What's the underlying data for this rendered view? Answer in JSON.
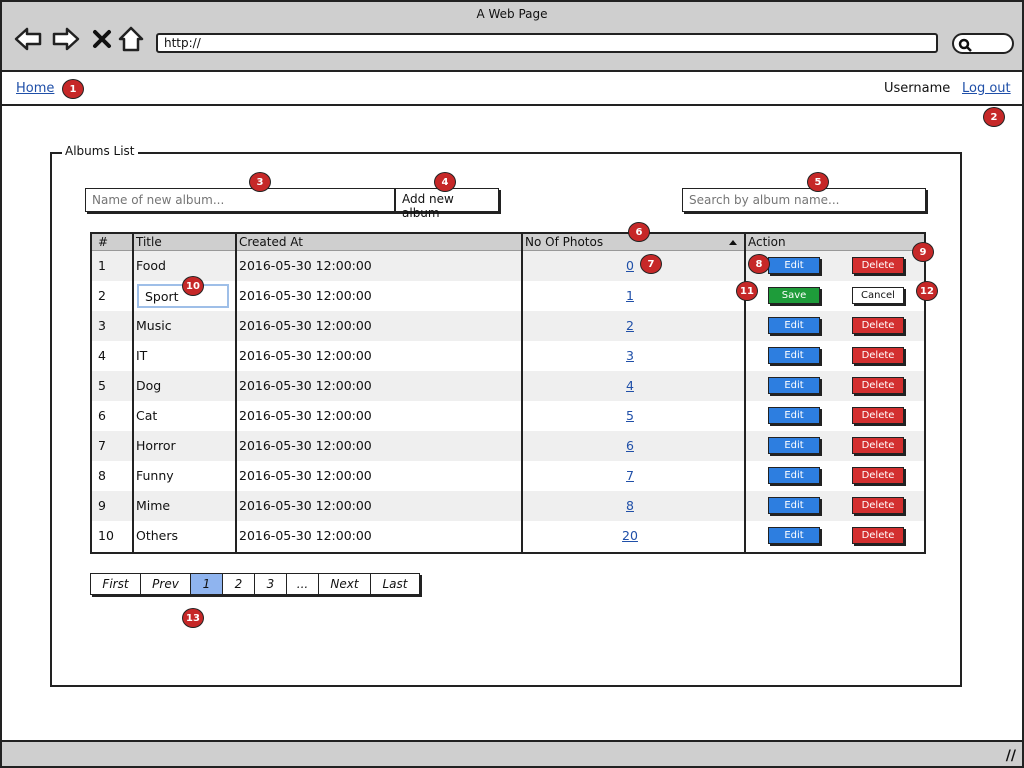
{
  "window": {
    "title": "A Web Page",
    "url": "http://"
  },
  "topnav": {
    "home": "Home",
    "username": "Username",
    "logout": "Log out"
  },
  "panel": {
    "legend": "Albums List"
  },
  "form": {
    "new_album_placeholder": "Name of new album...",
    "add_button": "Add new album",
    "search_placeholder": "Search by album name..."
  },
  "table": {
    "headers": [
      "#",
      "Title",
      "Created At",
      "No Of Photos",
      "Action"
    ],
    "rows": [
      {
        "num": "1",
        "title": "Food",
        "created": "2016-05-30 12:00:00",
        "photos": "0"
      },
      {
        "num": "2",
        "title": "Sport",
        "created": "2016-05-30 12:00:00",
        "photos": "1"
      },
      {
        "num": "3",
        "title": "Music",
        "created": "2016-05-30 12:00:00",
        "photos": "2"
      },
      {
        "num": "4",
        "title": "IT",
        "created": "2016-05-30 12:00:00",
        "photos": "3"
      },
      {
        "num": "5",
        "title": "Dog",
        "created": "2016-05-30 12:00:00",
        "photos": "4"
      },
      {
        "num": "6",
        "title": "Cat",
        "created": "2016-05-30 12:00:00",
        "photos": "5"
      },
      {
        "num": "7",
        "title": "Horror",
        "created": "2016-05-30 12:00:00",
        "photos": "6"
      },
      {
        "num": "8",
        "title": "Funny",
        "created": "2016-05-30 12:00:00",
        "photos": "7"
      },
      {
        "num": "9",
        "title": "Mime",
        "created": "2016-05-30 12:00:00",
        "photos": "8"
      },
      {
        "num": "10",
        "title": "Others",
        "created": "2016-05-30 12:00:00",
        "photos": "20"
      }
    ],
    "edit_label": "Edit",
    "delete_label": "Delete",
    "save_label": "Save",
    "cancel_label": "Cancel"
  },
  "pager": [
    "First",
    "Prev",
    "1",
    "2",
    "3",
    "...",
    "Next",
    "Last"
  ],
  "pager_active": "1",
  "callouts": [
    "1",
    "2",
    "3",
    "4",
    "5",
    "6",
    "7",
    "8",
    "9",
    "10",
    "11",
    "12",
    "13"
  ],
  "colors": {
    "edit": "#2d7ee0",
    "delete": "#d32f2f",
    "save": "#1e9c3a",
    "callout": "#c62828",
    "pager_active": "#8fb4ef"
  },
  "icons": [
    "back-arrow-icon",
    "forward-arrow-icon",
    "stop-icon",
    "home-icon",
    "search-icon",
    "sort-asc-icon",
    "resize-grip-icon"
  ]
}
